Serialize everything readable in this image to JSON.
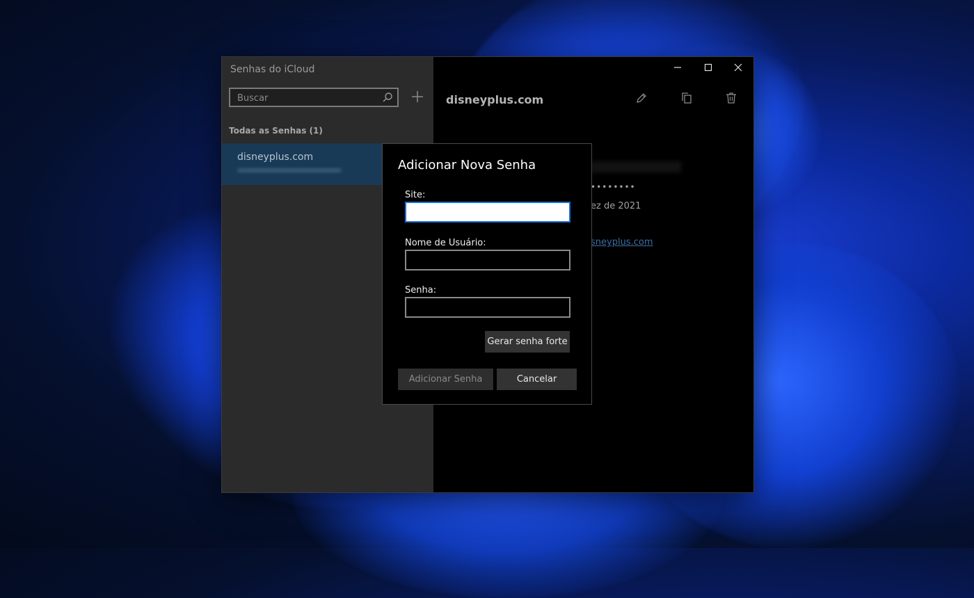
{
  "app": {
    "title": "Senhas do iCloud"
  },
  "sidebar": {
    "search_placeholder": "Buscar",
    "list_header": "Todas as Senhas (1)",
    "items": [
      {
        "site": "disneyplus.com"
      }
    ]
  },
  "detail": {
    "title": "disneyplus.com",
    "password_mask": "••••••••",
    "date_fragment": "ez de 2021",
    "link_fragment": "sneyplus.com"
  },
  "dialog": {
    "title": "Adicionar Nova Senha",
    "site_label": "Site:",
    "site_value": "",
    "username_label": "Nome de Usuário:",
    "username_value": "",
    "password_label": "Senha:",
    "password_value": "",
    "generate_label": "Gerar senha forte",
    "add_label": "Adicionar Senha",
    "cancel_label": "Cancelar"
  },
  "colors": {
    "accent_focus": "#1a6fd6",
    "selected_item": "#183a57",
    "link": "#3a6ea5"
  },
  "icons": [
    "search-icon",
    "add-icon",
    "edit-icon",
    "copy-icon",
    "trash-icon",
    "minimize-icon",
    "maximize-icon",
    "close-icon"
  ]
}
